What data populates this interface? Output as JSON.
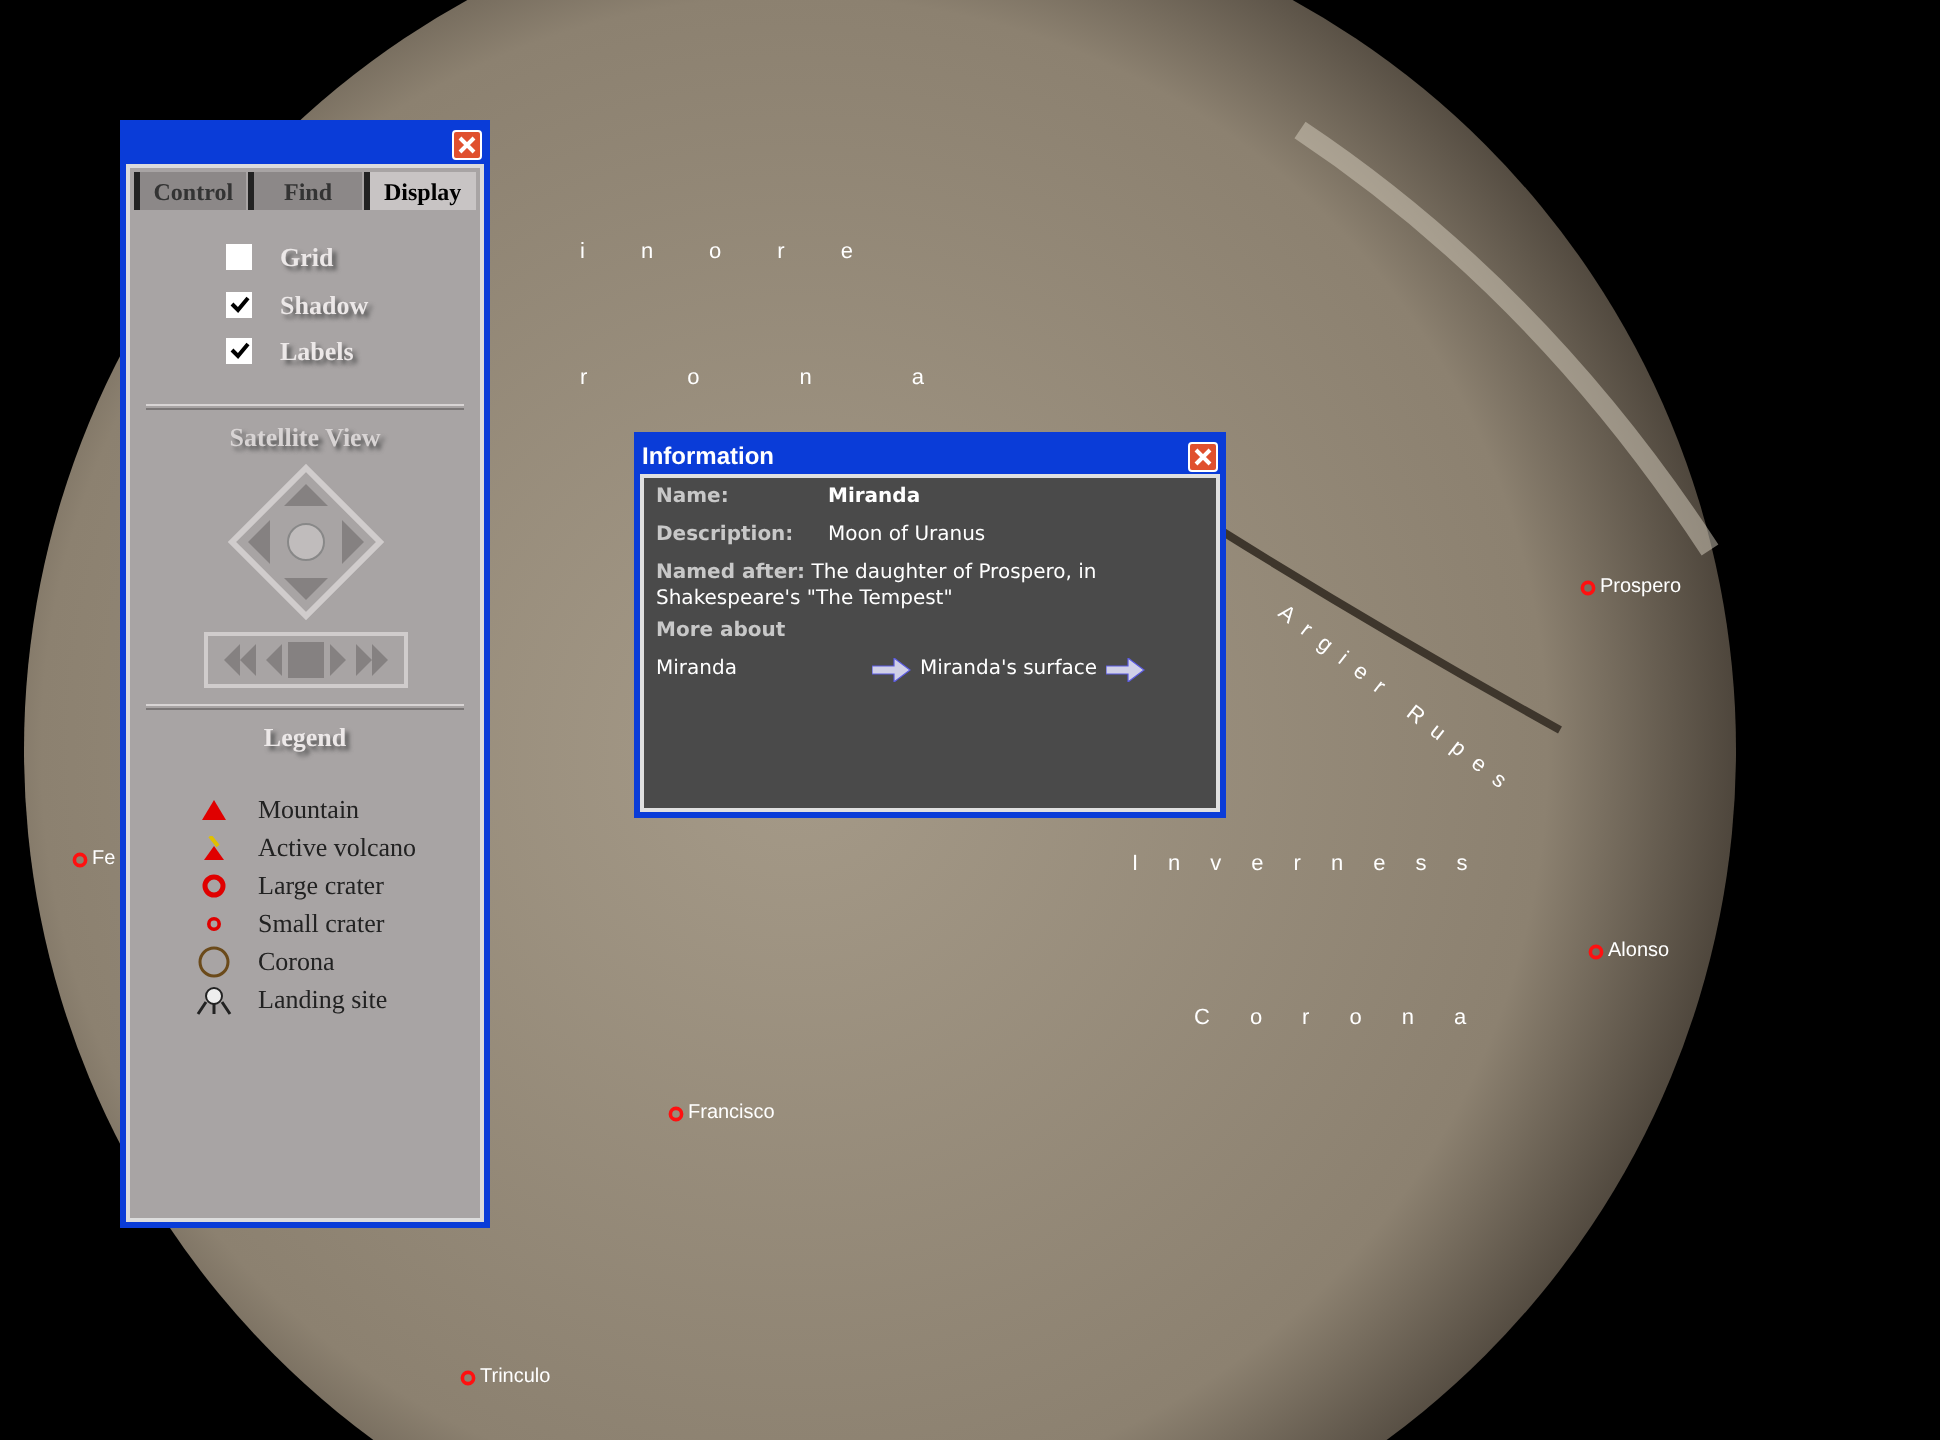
{
  "control_panel": {
    "tabs": [
      {
        "label": "Control",
        "selected": false
      },
      {
        "label": "Find",
        "selected": false
      },
      {
        "label": "Display",
        "selected": true
      }
    ],
    "options": [
      {
        "label": "Grid",
        "checked": false
      },
      {
        "label": "Shadow",
        "checked": true
      },
      {
        "label": "Labels",
        "checked": true
      }
    ],
    "satellite_view_title": "Satellite View",
    "legend_title": "Legend",
    "legend": [
      {
        "kind": "mountain",
        "label": "Mountain"
      },
      {
        "kind": "volcano",
        "label": "Active volcano"
      },
      {
        "kind": "large_crater",
        "label": "Large crater"
      },
      {
        "kind": "small_crater",
        "label": "Small crater"
      },
      {
        "kind": "corona",
        "label": "Corona"
      },
      {
        "kind": "landing_site",
        "label": "Landing site"
      }
    ]
  },
  "info_window": {
    "title": "Information",
    "fields": [
      {
        "label": "Name:",
        "value": "Miranda"
      },
      {
        "label": "Description:",
        "value": "Moon of Uranus"
      }
    ],
    "named_after_label": "Named after:",
    "named_after_value": "The daughter of Prospero, in Shakespeare's \"The Tempest\"",
    "more_about_label": "More about",
    "links": [
      "Miranda",
      "Miranda's surface"
    ]
  },
  "map_labels": [
    {
      "kind": "region",
      "text": "inore"
    },
    {
      "kind": "region",
      "text": "rona"
    },
    {
      "kind": "region",
      "text": "Inverness"
    },
    {
      "kind": "region",
      "text": "Corona"
    },
    {
      "kind": "scarp",
      "text": "Argier Rupes"
    },
    {
      "kind": "crater",
      "text": "Prospero"
    },
    {
      "kind": "crater",
      "text": "Alonso"
    },
    {
      "kind": "crater",
      "text": "Francisco"
    },
    {
      "kind": "crater",
      "text": "Trinculo"
    },
    {
      "kind": "crater",
      "text": "Fe"
    }
  ]
}
